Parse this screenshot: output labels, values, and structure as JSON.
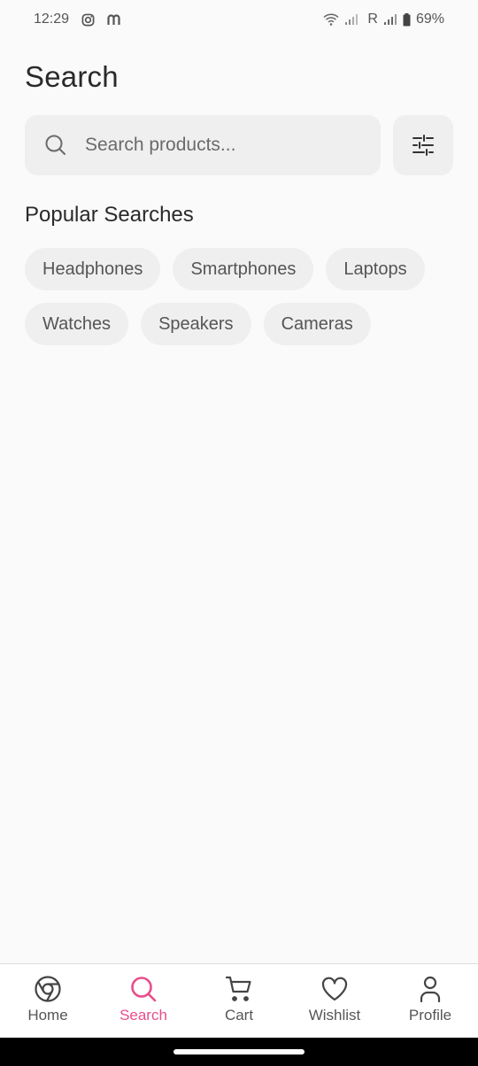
{
  "status_bar": {
    "time": "12:29",
    "app_icons": [
      "instagram-icon",
      "m-icon"
    ],
    "carrier_roaming": "R",
    "battery": "69%"
  },
  "page": {
    "title": "Search"
  },
  "search": {
    "placeholder": "Search products...",
    "value": ""
  },
  "popular": {
    "title": "Popular Searches",
    "chips": [
      "Headphones",
      "Smartphones",
      "Laptops",
      "Watches",
      "Speakers",
      "Cameras"
    ]
  },
  "nav": {
    "items": [
      {
        "label": "Home",
        "icon": "home-icon"
      },
      {
        "label": "Search",
        "icon": "search-icon",
        "active": true
      },
      {
        "label": "Cart",
        "icon": "cart-icon"
      },
      {
        "label": "Wishlist",
        "icon": "heart-icon"
      },
      {
        "label": "Profile",
        "icon": "person-icon"
      }
    ]
  },
  "colors": {
    "accent": "#e84d8a",
    "background": "#fafafa",
    "chip_bg": "#efefef"
  }
}
